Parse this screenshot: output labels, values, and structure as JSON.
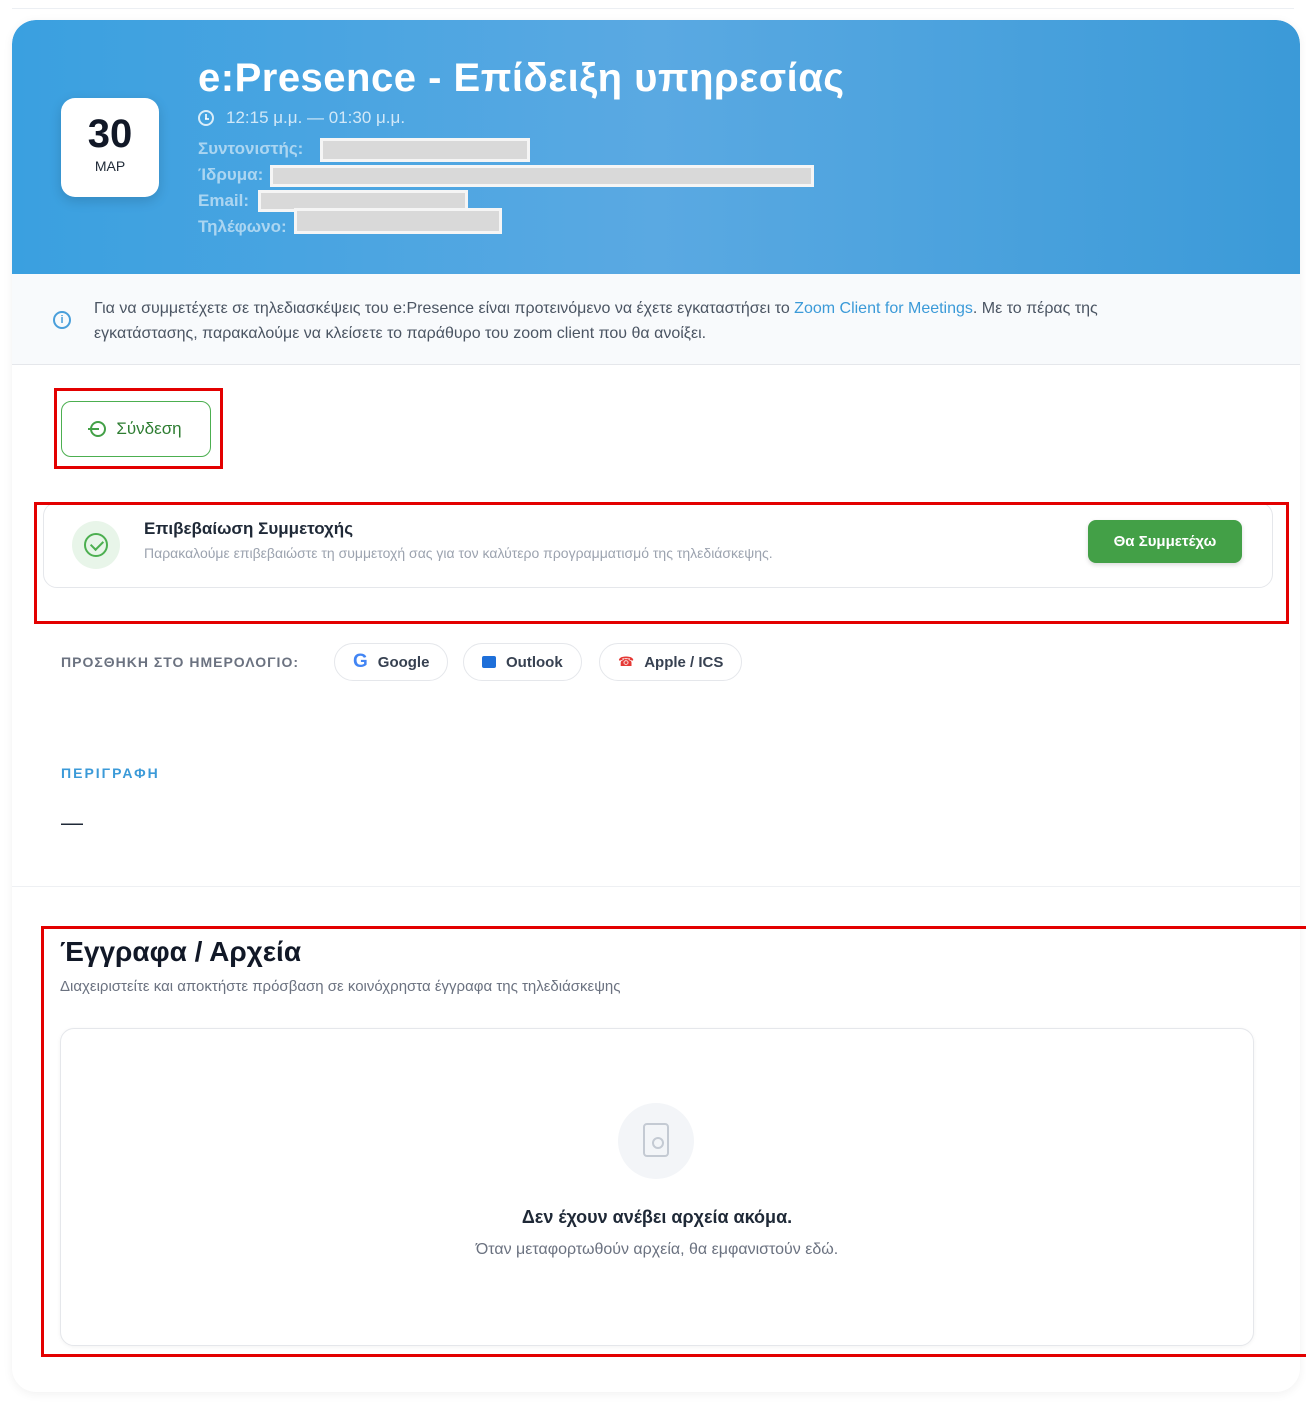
{
  "event": {
    "title": "e:Presence - Επίδειξη υπηρεσίας",
    "date_day": "30",
    "date_month": "ΜΑΡ",
    "time": "12:15 μ.μ. — 01:30 μ.μ.",
    "coordinator_label": "Συντονιστής:",
    "institution_label": "Ίδρυμα:",
    "email_label": "Email:",
    "phone_label": "Τηλέφωνο:"
  },
  "info": {
    "text_before": "Για να συμμετέχετε σε τηλεδιασκέψεις του e:Presence είναι προτεινόμενο να έχετε εγκαταστήσει το ",
    "link": "Zoom Client for Meetings",
    "text_after": ". Με το πέρας της εγκατάστασης, παρακαλούμε να κλείσετε το παράθυρο του zoom client που θα ανοίξει."
  },
  "connect": {
    "label": "Σύνδεση"
  },
  "confirmation": {
    "title": "Επιβεβαίωση Συμμετοχής",
    "description": "Παρακαλούμε επιβεβαιώστε τη συμμετοχή σας για τον καλύτερο προγραμματισμό της τηλεδιάσκεψης.",
    "button": "Θα Συμμετέχω"
  },
  "calendar": {
    "label": "ΠΡΟΣΘΗΚΗ ΣΤΟ ΗΜΕΡΟΛΟΓΙΟ:",
    "buttons": [
      "Google",
      "Outlook",
      "Apple / ICS"
    ],
    "google_glyph": "G",
    "apple_glyph": "☎"
  },
  "description": {
    "heading": "ΠΕΡΙΓΡΑΦΗ",
    "value": "—"
  },
  "documents": {
    "title": "Έγγραφα / Αρχεία",
    "subtitle": "Διαχειριστείτε και αποκτήστε πρόσβαση σε κοινόχρηστα έγγραφα της τηλεδιάσκεψης",
    "empty_title": "Δεν έχουν ανέβει αρχεία ακόμα.",
    "empty_subtitle": "Όταν μεταφορτωθούν αρχεία, θα εμφανιστούν εδώ."
  },
  "colors": {
    "header_blue": "#3aa0e0",
    "accent_green": "#43a047",
    "link_blue": "#3b9ad8",
    "highlight_red": "#e30000"
  }
}
